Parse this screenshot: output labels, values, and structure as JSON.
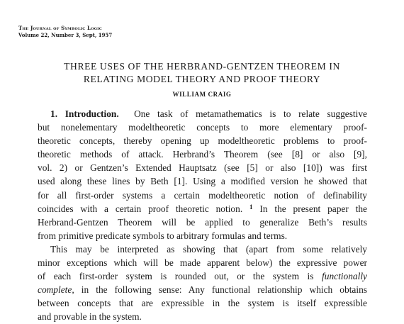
{
  "header": {
    "journal": "The Journal of Symbolic Logic",
    "volume": "Volume 22, Number 3, Sept, 1957"
  },
  "title_line1": "THREE USES OF THE HERBRAND-GENTZEN THEOREM IN",
  "title_line2": "RELATING MODEL THEORY AND PROOF THEORY",
  "author": "WILLIAM CRAIG",
  "section_heading": "1. Introduction.",
  "para1": [
    "One task of metamathematics is to relate suggestive",
    "but nonelementary modeltheoretic concepts to more elementary proof-",
    "theoretic concepts, thereby opening up modeltheoretic problems to proof-",
    "theoretic methods of attack. Herbrand’s Theorem (see [8] or also [9],",
    "vol. 2) or Gentzen’s Extended Hauptsatz (see [5] or also [10]) was first",
    "used along these lines by Beth [1]. Using a modified version he showed that",
    "for all first-order systems a certain modeltheoretic notion of definability",
    "coincides with a certain proof theoretic notion.",
    "In the present paper the",
    "Herbrand-Gentzen Theorem will be applied to generalize Beth’s results",
    "from primitive predicate symbols to arbitrary formulas and terms."
  ],
  "footnote_mark": "1",
  "para2": [
    "This may be interpreted as showing that (apart from some relatively",
    "minor exceptions which will be made apparent below) the expressive power",
    "of each first-order system is rounded out, or the system is",
    "functionally",
    "complete,",
    "in the following sense: Any functional relationship which obtains",
    "between concepts that are expressible in the system is itself expressible",
    "and provable in the system."
  ]
}
